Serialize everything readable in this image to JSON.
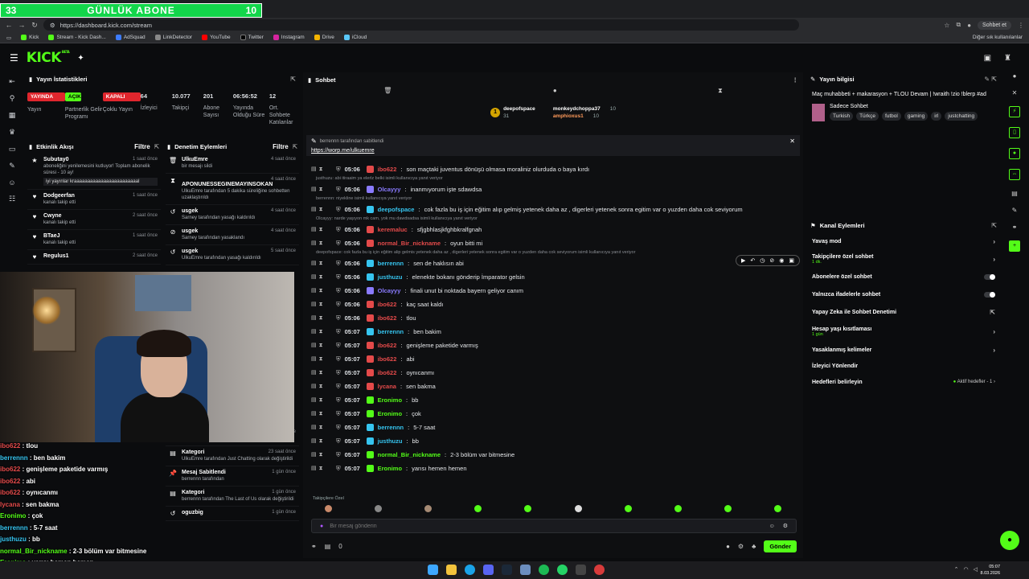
{
  "banner": {
    "left": "33",
    "title": "GÜNLÜK ABONE",
    "right": "10"
  },
  "browser": {
    "url": "https://dashboard.kick.com/stream",
    "chat_button": "Sohbet et",
    "bookmarks": [
      "Kick",
      "Stream - Kick Dash...",
      "AdSquad",
      "LinkDetector",
      "YouTube",
      "Twitter",
      "Instagram",
      "Drive",
      "iCloud"
    ],
    "bookmarks_right": "Diğer sık kullanılanlar"
  },
  "stats": {
    "title": "Yayın İstatistikleri",
    "items": [
      {
        "value": "YAYINDA",
        "label": "Yayın",
        "kind": "red"
      },
      {
        "value": "AÇIK",
        "label": "Partnerlik Gelir Programı",
        "kind": "green"
      },
      {
        "value": "KAPALI",
        "label": "Çoklu Yayın",
        "kind": "red"
      },
      {
        "value": "64",
        "label": "İzleyici",
        "kind": "text"
      },
      {
        "value": "10.077",
        "label": "Takipçi",
        "kind": "text"
      },
      {
        "value": "201",
        "label": "Abone Sayısı",
        "kind": "text"
      },
      {
        "value": "06:56:52",
        "label": "Yayında Olduğu Süre",
        "kind": "text"
      },
      {
        "value": "12",
        "label": "Ort. Sohbete Katılanlar",
        "kind": "text"
      }
    ]
  },
  "activity": {
    "title": "Etkinlik Akışı",
    "filter": "Filtre",
    "items": [
      {
        "name": "Subutay0",
        "time": "1 saat önce",
        "desc": "aboneliğini yenilemesini kutluyor! Toplam abonelik süresi - 10 ay!",
        "quote": "iyi yayınlar kraaaaaaaaaaaaaaaaaaaaaaaal"
      },
      {
        "name": "Dodgeerfan",
        "time": "1 saat önce",
        "desc": "kanalı takip etti",
        "quote": ""
      },
      {
        "name": "Cwyne",
        "time": "2 saat önce",
        "desc": "kanalı takip etti",
        "quote": ""
      },
      {
        "name": "BTaeJ",
        "time": "1 saat önce",
        "desc": "kanalı takip etti",
        "quote": ""
      },
      {
        "name": "Regulus1",
        "time": "2 saat önce",
        "desc": "",
        "quote": ""
      }
    ]
  },
  "moderation": {
    "title": "Denetim Eylemleri",
    "filter": "Filtre",
    "items": [
      {
        "icon": "🗑",
        "name": "UlkuEmre",
        "time": "4 saat önce",
        "desc": "bir mesajı sildi"
      },
      {
        "icon": "⧗",
        "name": "APONUNESSEGINEMAYINSOKAN",
        "time": "4 saat önce",
        "desc": "UlkuEmre tarafından 5 dakika süreliğine sohbetten uzaklaştırıldı"
      },
      {
        "icon": "↺",
        "name": "usgek",
        "time": "4 saat önce",
        "desc": "Sarney tarafından yasağı kaldırıldı"
      },
      {
        "icon": "⊘",
        "name": "usgek",
        "time": "4 saat önce",
        "desc": "Sarney tarafından yasaklandı"
      },
      {
        "icon": "↺",
        "name": "usgek",
        "time": "5 saat önce",
        "desc": "UlkuEmre tarafından yasağı kaldırıldı"
      },
      {
        "icon": "▤",
        "name": "Kategori",
        "time": "23 saat önce",
        "desc": "berrennn tarafından The Last of Us olarak değiştirildi"
      },
      {
        "icon": "▤",
        "name": "Kategori",
        "time": "23 saat önce",
        "desc": "UlkuEmre tarafından Just Chatting olarak değiştirildi"
      },
      {
        "icon": "📌",
        "name": "Mesaj Sabitlendi",
        "time": "1 gün önce",
        "desc": "berrennn tarafından"
      },
      {
        "icon": "▤",
        "name": "Kategori",
        "time": "1 gün önce",
        "desc": "berrennn tarafından The Last of Us olarak değiştirildi"
      },
      {
        "icon": "↺",
        "name": "oguzbig",
        "time": "1 gün önce",
        "desc": ""
      }
    ]
  },
  "chat": {
    "title": "Sohbet",
    "leaders": [
      {
        "name": "deepofspace",
        "count": "31"
      },
      {
        "name": "monkeydchoppa37",
        "count": "10"
      },
      {
        "name": "amphioxus1",
        "count": "10"
      }
    ],
    "pinned_by": "berrennn tarafından sabitlendi",
    "pinned_link": "https://worp.me/ulkuemre",
    "messages": [
      {
        "reply": "",
        "time": "05:06",
        "user": "ibo622",
        "color": "#e34a4a",
        "text": "son maçtaki juventus dönüşü olmasa moraliniz olurduda o baya kırdı"
      },
      {
        "reply": "justhuzu: abi itiraaim ya elerlz belki isimli kullanıcıya yanıt veriyor",
        "time": "05:06",
        "user": "Olcayyy",
        "color": "#8a7bff",
        "text": "inanmıyorum işte sdawdsa"
      },
      {
        "reply": "berrennn: niyekline isimli kullanıcıya yanıt veriyor",
        "time": "05:06",
        "user": "deepofspace",
        "color": "#36c5f0",
        "text": "cok fazla bu iş için eğitim alıp gelmiş yetenek daha az , digerleri yetenek sonra egitim var o yuzden daha cok seviyorum"
      },
      {
        "reply": "Olcayyy: narde yaşıyon mk cam, yok mu dawdsadsa isimli kullanıcıya yanıt veriyor",
        "time": "05:06",
        "user": "keremaluc",
        "color": "#e34a4a",
        "text": "sfjgbhlasjkfghbkralfgnah"
      },
      {
        "reply": "",
        "time": "05:06",
        "user": "normal_Bir_nickname",
        "color": "#e34a4a",
        "text": "oyun bitti mi"
      },
      {
        "reply": "deepofspace: cok fazla bu iş için eğitim alip gelmis yetenek daha az , digerleri yetenek sonra egitim var o yuzden daha cok seviyorum isimli kullanıcıya yanıt veriyor",
        "time": "05:06",
        "user": "berrennn",
        "color": "#36c5f0",
        "text": "sen de haklısın abi"
      },
      {
        "reply": "",
        "time": "05:06",
        "user": "justhuzu",
        "color": "#36c5f0",
        "text": "elenekte bokanı gönderip İmparator gelsin"
      },
      {
        "reply": "",
        "time": "05:06",
        "user": "Olcayyy",
        "color": "#8a7bff",
        "text": "finali unut bi noktada bayern geliyor canım"
      },
      {
        "reply": "",
        "time": "05:06",
        "user": "ibo622",
        "color": "#e34a4a",
        "text": "kaç saat kaldı"
      },
      {
        "reply": "",
        "time": "05:06",
        "user": "ibo622",
        "color": "#e34a4a",
        "text": "tlou"
      },
      {
        "reply": "",
        "time": "05:07",
        "user": "berrennn",
        "color": "#36c5f0",
        "text": "ben bakim"
      },
      {
        "reply": "",
        "time": "05:07",
        "user": "ibo622",
        "color": "#e34a4a",
        "text": "genişleme paketide varmış"
      },
      {
        "reply": "",
        "time": "05:07",
        "user": "ibo622",
        "color": "#e34a4a",
        "text": "abi"
      },
      {
        "reply": "",
        "time": "05:07",
        "user": "ibo622",
        "color": "#e34a4a",
        "text": "oynıcanmı"
      },
      {
        "reply": "",
        "time": "05:07",
        "user": "lycana",
        "color": "#e34a4a",
        "text": "sen bakma"
      },
      {
        "reply": "",
        "time": "05:07",
        "user": "Eronimo",
        "color": "#53fc18",
        "text": "bb"
      },
      {
        "reply": "",
        "time": "05:07",
        "user": "Eronimo",
        "color": "#53fc18",
        "text": "çok"
      },
      {
        "reply": "",
        "time": "05:07",
        "user": "berrennn",
        "color": "#36c5f0",
        "text": "5-7 saat"
      },
      {
        "reply": "",
        "time": "05:07",
        "user": "justhuzu",
        "color": "#36c5f0",
        "text": "bb"
      },
      {
        "reply": "",
        "time": "05:07",
        "user": "normal_Bir_nickname",
        "color": "#53fc18",
        "text": "2-3 bölüm var bitmesine"
      },
      {
        "reply": "",
        "time": "05:07",
        "user": "Eronimo",
        "color": "#53fc18",
        "text": "yarısı hemen hemen"
      }
    ],
    "subs_only_label": "Takipçilere Özel",
    "input_placeholder": "Bir mesaj gönderin",
    "footer_count": "0",
    "send_label": "Gönder"
  },
  "overlay_chat": [
    {
      "user": "ibo622",
      "color": "#e34a4a",
      "text": "tlou"
    },
    {
      "user": "berrennn",
      "color": "#36c5f0",
      "text": "ben bakim"
    },
    {
      "user": "ibo622",
      "color": "#e34a4a",
      "text": "genişleme paketide varmış"
    },
    {
      "user": "ibo622",
      "color": "#e34a4a",
      "text": "abi"
    },
    {
      "user": "ibo622",
      "color": "#e34a4a",
      "text": "oynıcanmı"
    },
    {
      "user": "lycana",
      "color": "#e34a4a",
      "text": "sen bakma"
    },
    {
      "user": "Eronimo",
      "color": "#53fc18",
      "text": "çok"
    },
    {
      "user": "berrennn",
      "color": "#36c5f0",
      "text": "5-7 saat"
    },
    {
      "user": "justhuzu",
      "color": "#36c5f0",
      "text": "bb"
    },
    {
      "user": "normal_Bir_nickname",
      "color": "#53fc18",
      "text": "2-3 bölüm var bitmesine"
    },
    {
      "user": "Eronimo",
      "color": "#53fc18",
      "text": "yarısı hemen hemen"
    }
  ],
  "stream_info": {
    "title": "Yayın bilgisi",
    "stream_title": "Maç muhabbeti + makarasyon + TLOU Devam | !wraith !zio !blerp #ad",
    "category": "Sadece Sohbet",
    "tags": [
      "Turkish",
      "Türkçe",
      "futbol",
      "gaming",
      "irl",
      "justchatting"
    ]
  },
  "channel_actions": {
    "title": "Kanal Eylemleri",
    "rows": [
      {
        "label": "Yavaş mod",
        "sub": "",
        "control": "chevron"
      },
      {
        "label": "Takipçilere özel sohbet",
        "sub": "1 dk.",
        "control": "chevron"
      },
      {
        "label": "Abonelere özel sohbet",
        "sub": "",
        "control": "toggle"
      },
      {
        "label": "Yalnızca ifadelerle sohbet",
        "sub": "",
        "control": "toggle"
      },
      {
        "label": "Yapay Zeka ile Sohbet Denetimi",
        "sub": "",
        "control": "link"
      },
      {
        "label": "Hesap yaşı kısıtlaması",
        "sub": "1 gün",
        "control": "chevron"
      },
      {
        "label": "Yasaklanmış kelimeler",
        "sub": "",
        "control": "chevron"
      },
      {
        "label": "İzleyici Yönlendir",
        "sub": "",
        "control": "none"
      },
      {
        "label": "Hedefleri belirleyin",
        "sub": "",
        "control": "goal"
      }
    ],
    "goal_text": "Aktif hedefler - 1"
  },
  "taskbar": {
    "time": "05:07",
    "date": "8.03.2026"
  }
}
